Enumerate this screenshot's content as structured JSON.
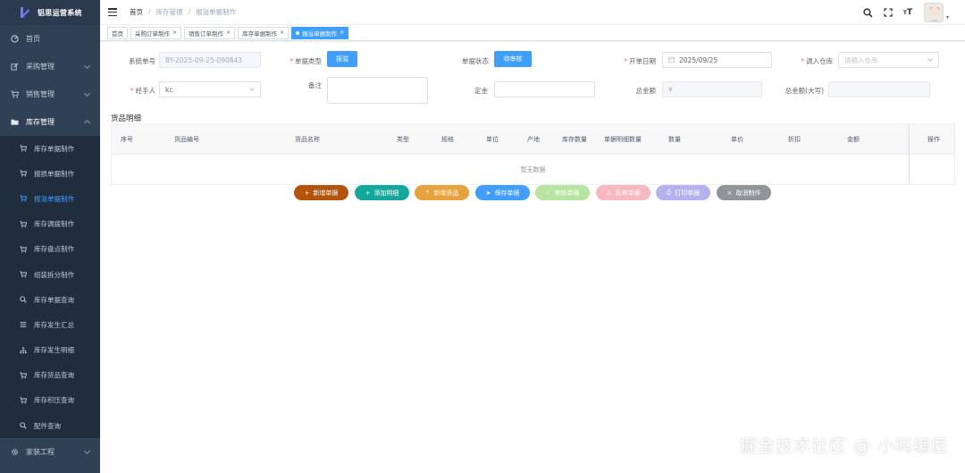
{
  "app": {
    "title": "铝思运营系统"
  },
  "sidebar": {
    "items": [
      {
        "label": "首页"
      },
      {
        "label": "采购管理"
      },
      {
        "label": "销售管理"
      },
      {
        "label": "库存管理"
      }
    ],
    "submenu": [
      {
        "label": "库存单据制作"
      },
      {
        "label": "报损单据制作"
      },
      {
        "label": "报溢单据制作"
      },
      {
        "label": "库存调拨制作"
      },
      {
        "label": "库存盘点制作"
      },
      {
        "label": "组装拆分制作"
      },
      {
        "label": "库存单据查询"
      },
      {
        "label": "库存发生汇总"
      },
      {
        "label": "库存发生明细"
      },
      {
        "label": "库存货品查询"
      },
      {
        "label": "库存积压查询"
      },
      {
        "label": "配件查询"
      }
    ],
    "bottom": {
      "label": "家装工程"
    }
  },
  "header": {
    "breadcrumb": [
      "首页",
      "库存管理",
      "报溢单据制作"
    ],
    "font_icon_label": "T"
  },
  "tags": [
    {
      "label": "首页"
    },
    {
      "label": "采购订单制作"
    },
    {
      "label": "销售订单制作"
    },
    {
      "label": "库存单据制作"
    },
    {
      "label": "报溢单据制作"
    }
  ],
  "form": {
    "system_no": {
      "label": "系统单号",
      "value": "BY-2025-09-25-090843"
    },
    "doc_type": {
      "label": "单据类型",
      "value": "报溢"
    },
    "doc_status": {
      "label": "单据状态",
      "value": "待审核"
    },
    "open_date": {
      "label": "开单日期",
      "value": "2025/09/25"
    },
    "warehouse": {
      "label": "调入仓库",
      "placeholder": "请输入仓库"
    },
    "handler": {
      "label": "经手人",
      "value": "kc"
    },
    "remark": {
      "label": "备注"
    },
    "deposit": {
      "label": "定金"
    },
    "total": {
      "label": "总金额",
      "value": "¥"
    },
    "total_upper": {
      "label": "总金额(大写)"
    }
  },
  "goods": {
    "title": "货品明细",
    "columns": [
      "序号",
      "货品编号",
      "货品名称",
      "类型",
      "规格",
      "单位",
      "产地",
      "库存数量",
      "单据明细数量",
      "数量",
      "单价",
      "折扣",
      "金额",
      "操作"
    ],
    "empty_text": "暂无数据"
  },
  "actions": [
    {
      "label": "新增单据",
      "color": "#b35409"
    },
    {
      "label": "添加明细",
      "color": "#14a79c"
    },
    {
      "label": "新增货品",
      "color": "#e6a23c"
    },
    {
      "label": "保存单据",
      "color": "#409eff"
    },
    {
      "label": "审核单据",
      "color": "#b7e4a0"
    },
    {
      "label": "反审单据",
      "color": "#f8b8bf"
    },
    {
      "label": "打印单据",
      "color": "#b5b3ef"
    },
    {
      "label": "取消制作",
      "color": "#909399"
    }
  ],
  "watermark": "掘金技术社区 @ 小码编匠"
}
